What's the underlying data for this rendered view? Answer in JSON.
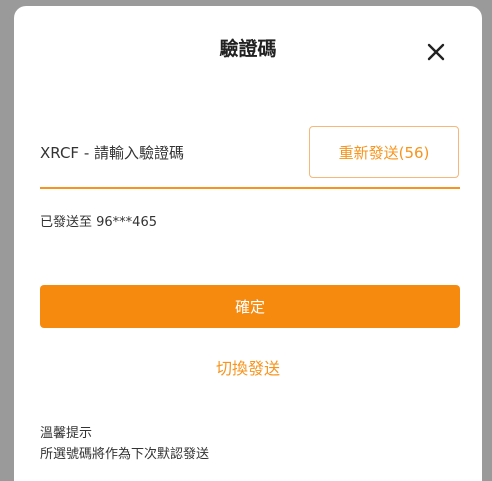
{
  "dialog": {
    "title": "驗證碼",
    "close_icon": "close-icon"
  },
  "code_field": {
    "prefix": "XRCF - ",
    "placeholder": "請輸入驗證碼",
    "value": ""
  },
  "resend_button": {
    "label": "重新發送(56)"
  },
  "sent_to": "已發送至 96***465",
  "confirm_button": {
    "label": "確定"
  },
  "switch_link": {
    "label": "切換發送"
  },
  "tips": {
    "title": "溫馨提示",
    "body": "所選號碼將作為下次默認發送"
  },
  "colors": {
    "accent": "#f58a0f",
    "accent_light": "#f5b77a",
    "text": "#333333",
    "backdrop": "#9a9a9a"
  }
}
